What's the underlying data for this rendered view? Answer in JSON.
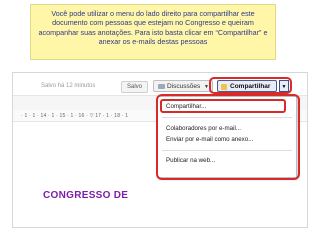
{
  "callout": {
    "text": "Você pode utilizar o menu do lado direito para compartilhar este documento com pessoas que estejam no Congresso e queiram acompanhar suas anotações. Para isto basta clicar em “Compartilhar” e anexar os e-mails destas pessoas"
  },
  "toolbar": {
    "saved_status": "Salvo há 12 minutos",
    "save_label": "Salvo",
    "discussions_label": "Discussões",
    "share_label": "Compartilhar"
  },
  "ruler": {
    "text": "· 1 · 1 · 14 · 1 · 15 · 1 · 16 · ▽ 17 · 1 · 18 · 1"
  },
  "share_menu": {
    "items": [
      {
        "label": "Compartilhar..."
      },
      {
        "label": "Colaboradores por e-mail..."
      },
      {
        "label": "Enviar por e-mail como anexo..."
      },
      {
        "label": "Publicar na web..."
      }
    ]
  },
  "document": {
    "heading": "CONGRESSO DE"
  },
  "colors": {
    "highlight": "#d72b2b",
    "callout_bg": "#fff6a8",
    "callout_text": "#2d3a8c",
    "heading": "#7a1fa8"
  }
}
